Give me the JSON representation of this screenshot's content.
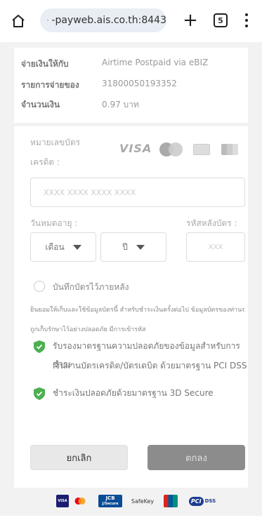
{
  "browser": {
    "url": "-payweb.ais.co.th:8443",
    "tab_count": "5",
    "new_tab_symbol": "+"
  },
  "summary": {
    "rows": [
      {
        "label": "จ่ายเงินให้กับ",
        "value": "Airtime Postpaid via eBIZ"
      },
      {
        "label": "รายการจ่ายของ",
        "value": "31800050193352"
      },
      {
        "label": "จำนวนเงิน",
        "value": "0.97 บาท"
      }
    ]
  },
  "payment": {
    "card_number_label_line1": "หมายเลขบัตร",
    "card_number_label_line2": "เครดิต :",
    "card_brand_visa": "VISA",
    "card_number_placeholder": "XXXX XXXX XXXX XXXX",
    "expiry_label": "วันหมดอายุ :",
    "month_placeholder": "เดือน",
    "year_placeholder": "ปี",
    "cvv_label": "รหัสหลังบัตร :",
    "cvv_placeholder": "XXX",
    "save_card_label": "บันทึกบัตรไว้ภายหลัง",
    "consent_line1": "ยินยอมให้เก็บและใช้ข้อมูลบัตรนี้ สำหรับชำระเงินครั้งต่อไป ข้อมูลบัตรของท่านจะ",
    "consent_line2": "ถูกเก็บรักษาไว้อย่างปลอดภัย มีการเข้ารหัส",
    "security_line1": "รับรองมาตรฐานความปลอดภัยของข้อมูลสำหรับการชำระ",
    "security_line2": "เงินผ่านบัตรเครดิต/บัตรเดบิต ด้วยมาตรฐาน PCI DSS",
    "secure3d_line": "ชำระเงินปลอดภัยด้วยมาตรฐาน 3D Secure",
    "cancel_label": "ยกเลิก",
    "ok_label": "ตกลง"
  },
  "footer": {
    "logos": [
      "VISA",
      "mastercard",
      "JCB J/Secure",
      "SafeKey",
      "UnionPay",
      "PCI DSS"
    ],
    "jcb_text": "JCB",
    "jsecure_text": "J/Secure",
    "safekey_text": "SafeKey",
    "pci_text": "PCI",
    "dss_text": "DSS",
    "visa_text": "VISA"
  },
  "colors": {
    "shield_green": "#4caf50",
    "ok_button": "#8c8c8c",
    "url_pill": "#e9edf4"
  }
}
